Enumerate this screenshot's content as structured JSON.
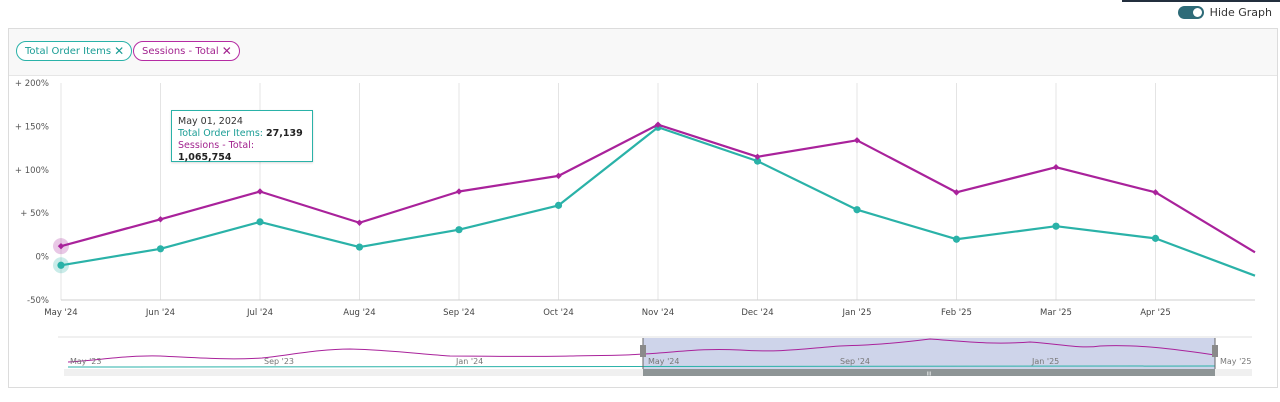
{
  "hide_graph": {
    "label": "Hide Graph",
    "on": true
  },
  "chips": [
    {
      "label": "Total Order Items",
      "close": "✕"
    },
    {
      "label": "Sessions - Total",
      "close": "✕"
    }
  ],
  "colors": {
    "teal": "#2ab2a8",
    "purple": "#a9229b",
    "navigator_fill": "#c6cde6"
  },
  "tooltip": {
    "date": "May 01, 2024",
    "series1_label": "Total Order Items:",
    "series1_value": "27,139",
    "series2_label": "Sessions - Total:",
    "series2_value": "1,065,754"
  },
  "chart_data": {
    "type": "line",
    "x": [
      "May '24",
      "Jun '24",
      "Jul '24",
      "Aug '24",
      "Sep '24",
      "Oct '24",
      "Nov '24",
      "Dec '24",
      "Jan '25",
      "Feb '25",
      "Mar '25",
      "Apr '25",
      "May '25"
    ],
    "x_tick_labels": [
      "May '24",
      "Jun '24",
      "Jul '24",
      "Aug '24",
      "Sep '24",
      "Oct '24",
      "Nov '24",
      "Dec '24",
      "Jan '25",
      "Feb '25",
      "Mar '25",
      "Apr '25"
    ],
    "series": [
      {
        "name": "Total Order Items",
        "color": "#2ab2a8",
        "values": [
          -10,
          9,
          40,
          11,
          31,
          59,
          149,
          110,
          54,
          20,
          35,
          21,
          -22
        ]
      },
      {
        "name": "Sessions - Total",
        "color": "#a9229b",
        "values": [
          12,
          43,
          75,
          39,
          75,
          93,
          152,
          115,
          134,
          74,
          103,
          74,
          5
        ]
      }
    ],
    "y_ticks": [
      "+ 200%",
      "+ 150%",
      "+ 100%",
      "+ 50%",
      "0%",
      "-50%"
    ],
    "ylim": [
      -50,
      200
    ],
    "grid": "vertical",
    "navigator": {
      "labels": [
        "May '23",
        "Sep '23",
        "Jan '24",
        "May '24",
        "Sep '24",
        "Jan '25",
        "May '25"
      ],
      "selected_from": "May '24",
      "selected_to": "May '25",
      "handle_grip": "III"
    }
  }
}
